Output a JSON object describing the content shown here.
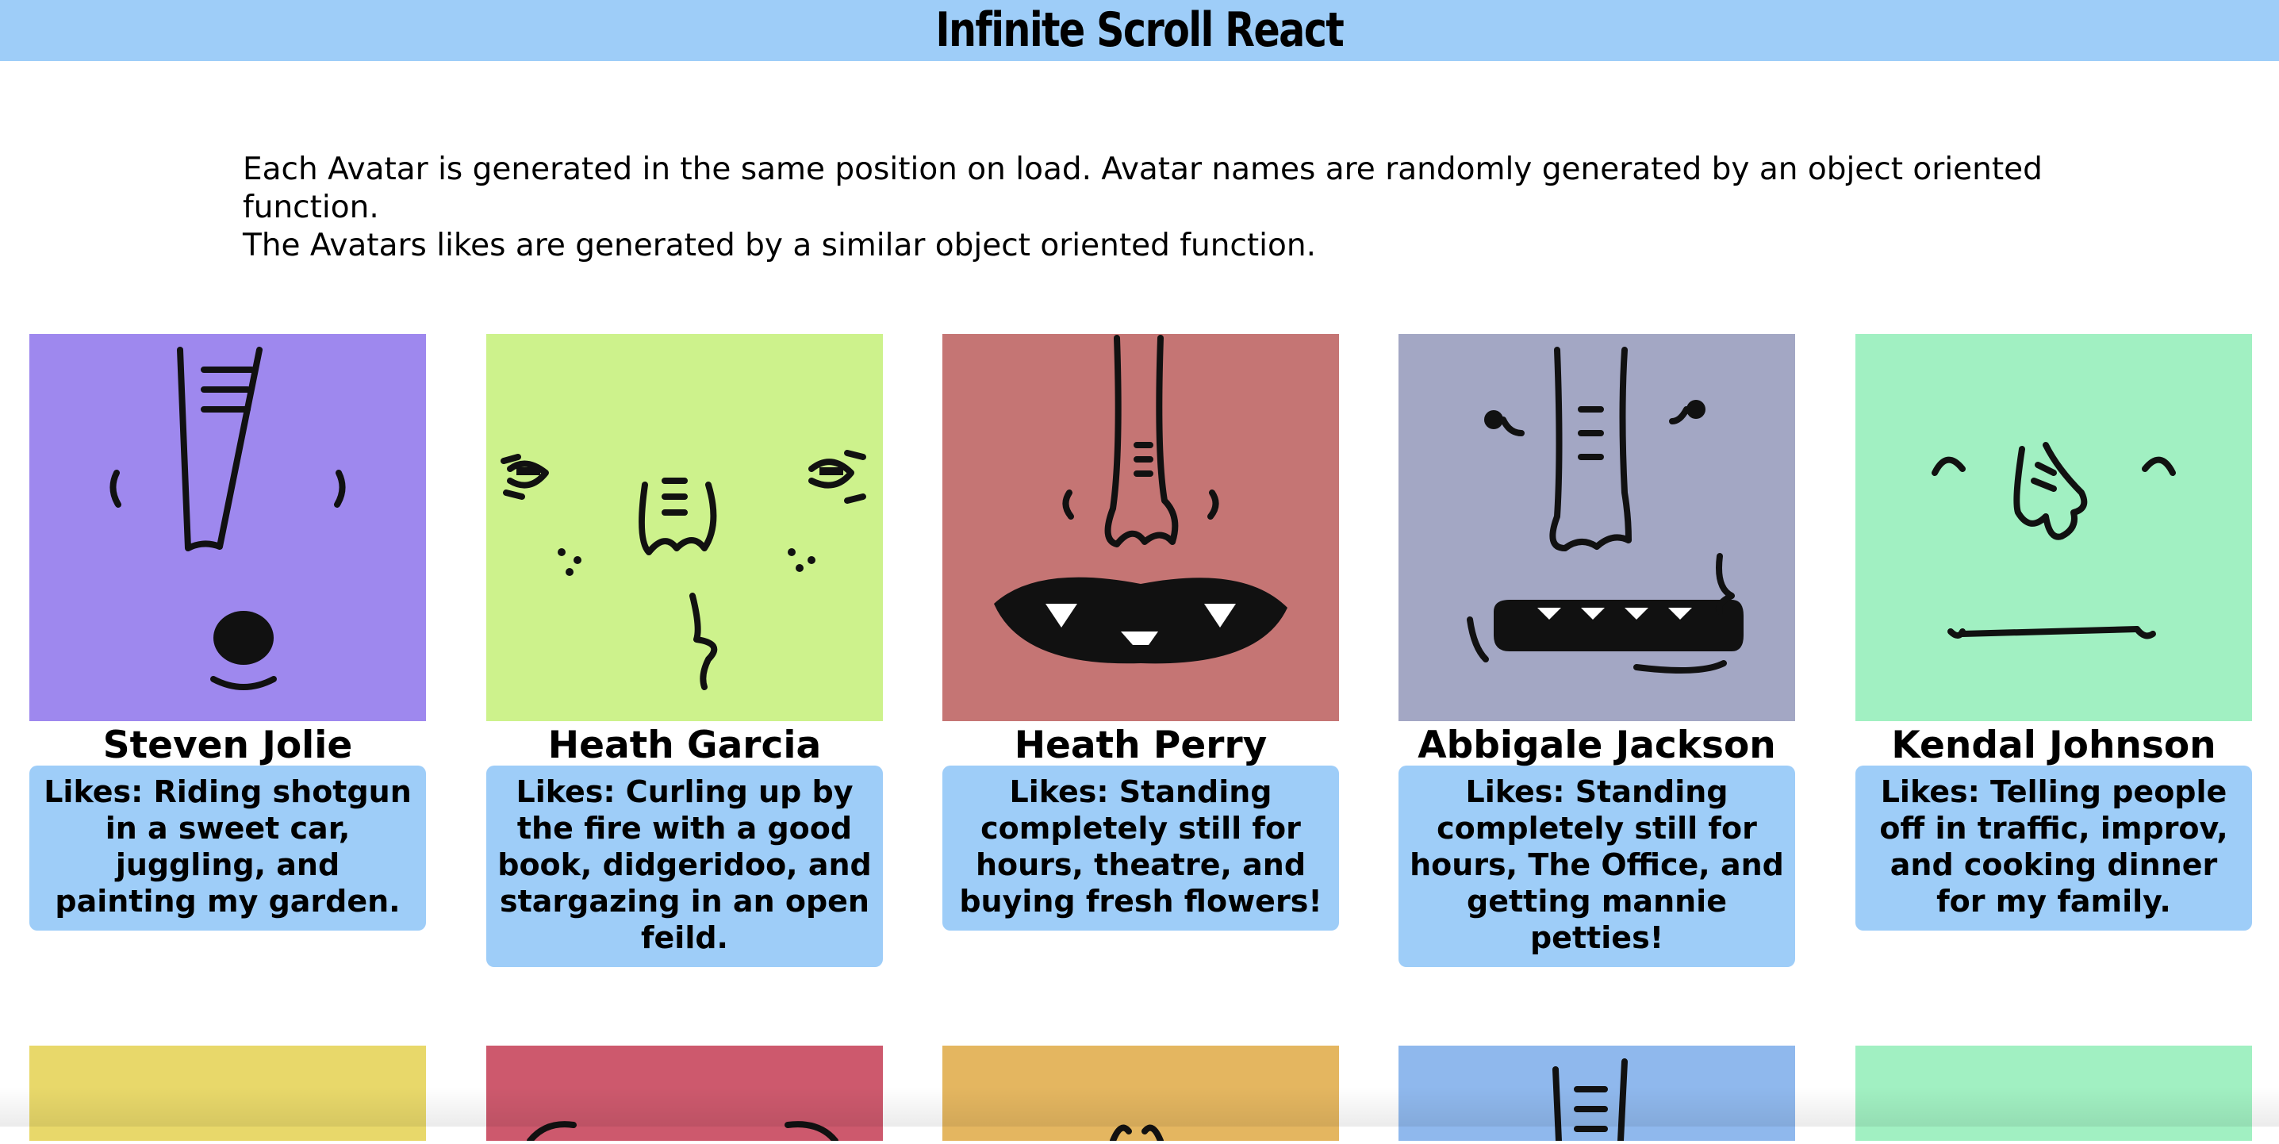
{
  "header": {
    "title": "Infinite Scroll React"
  },
  "intro": {
    "line1": "Each Avatar is generated in the same position on load. Avatar names are randomly generated by an object oriented function.",
    "line2": "The Avatars likes are generated by a similar object oriented function."
  },
  "cards": [
    {
      "name": "Steven Jolie",
      "likes": "Likes: Riding shotgun in a sweet car, juggling, and painting my garden.",
      "color": "#9e88ee"
    },
    {
      "name": "Heath Garcia",
      "likes": "Likes: Curling up by the fire with a good book, didgeridoo, and stargazing in an open feild.",
      "color": "#cdf28c"
    },
    {
      "name": "Heath Perry",
      "likes": "Likes: Standing completely still for hours, theatre, and buying fresh flowers!",
      "color": "#c57574"
    },
    {
      "name": "Abbigale Jackson",
      "likes": "Likes: Standing completely still for hours, The Office, and getting mannie petties!",
      "color": "#a3a7c4"
    },
    {
      "name": "Kendal Johnson",
      "likes": "Likes: Telling people off in traffic, improv, and cooking dinner for my family.",
      "color": "#a1f0c2"
    }
  ],
  "next_row_colors": [
    "#e8d86a",
    "#cd596d",
    "#e4b660",
    "#8fb8ed",
    "#a1f0c2"
  ],
  "colors": {
    "header_bg": "#9ecdf8",
    "likes_bg": "#9ecdf8"
  }
}
